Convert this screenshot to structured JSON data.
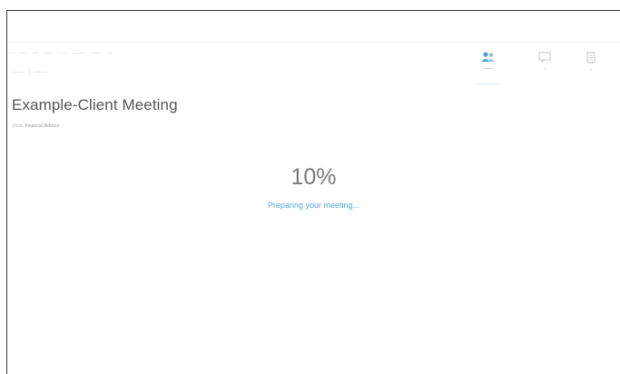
{
  "meeting": {
    "title": "Example-Client Meeting",
    "host_label": "Host:",
    "host_name": "Financial Advisor"
  },
  "loading": {
    "percent": "10%",
    "progress": 10,
    "status": "Preparing your meeting..."
  },
  "toolbar": {
    "buttons": [
      {
        "id": "participants",
        "icon": "people-icon",
        "active": true
      },
      {
        "id": "chat",
        "icon": "chat-icon",
        "active": false
      },
      {
        "id": "notes",
        "icon": "notes-icon",
        "active": false
      }
    ]
  },
  "colors": {
    "accent": "#57a6d8",
    "title_text": "#555555",
    "percent_text": "#7a7a7a"
  }
}
